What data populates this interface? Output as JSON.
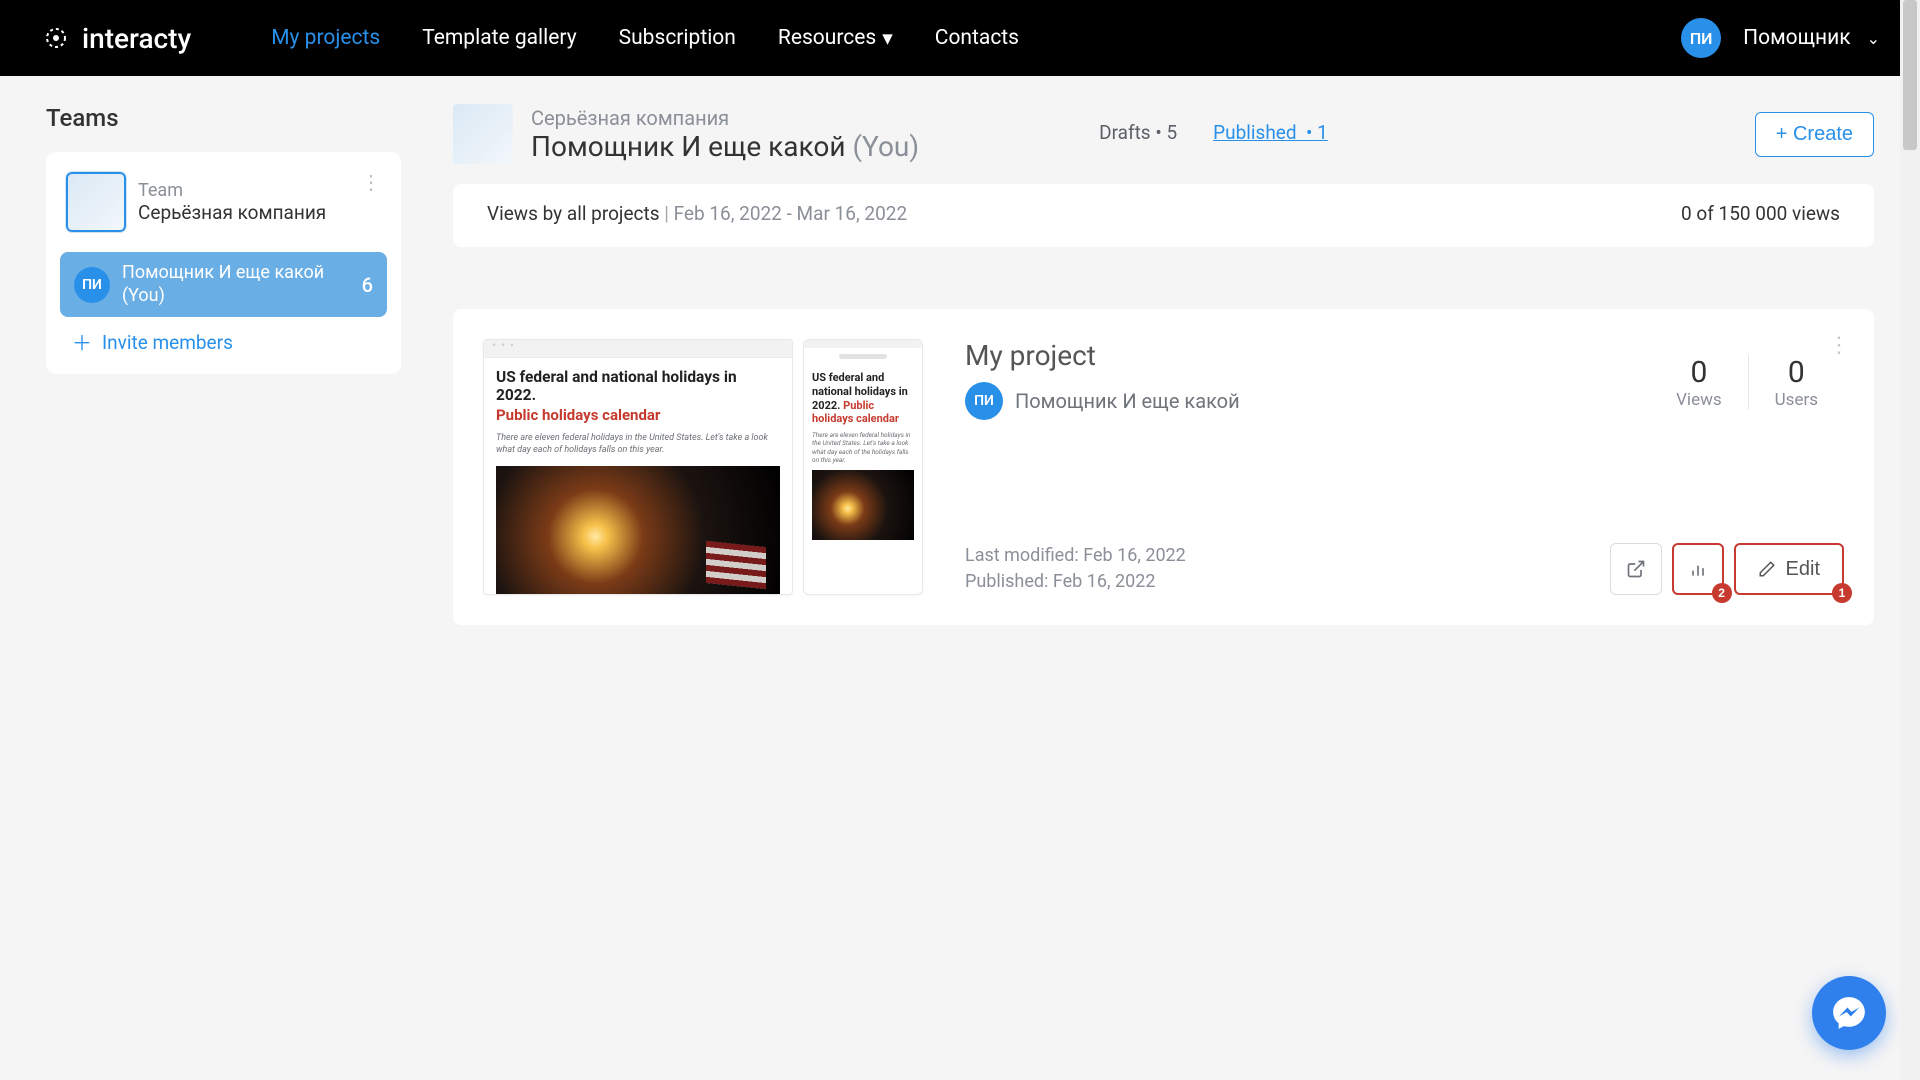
{
  "nav": {
    "brand": "interacty",
    "links": [
      "My projects",
      "Template gallery",
      "Subscription",
      "Resources",
      "Contacts"
    ]
  },
  "user": {
    "initials": "ПИ",
    "name": "Помощник"
  },
  "sidebar": {
    "title": "Teams",
    "team": {
      "label": "Team",
      "name": "Серьёзная компания"
    },
    "member": {
      "initials": "ПИ",
      "name": "Помощник И еще какой (You)",
      "count": "6"
    },
    "invite": "Invite members"
  },
  "workspace": {
    "company": "Серьёзная компания",
    "name": "Помощник И еще какой",
    "you": "(You)",
    "drafts_label": "Drafts",
    "drafts_count": "5",
    "published_label": "Published",
    "published_count": "1",
    "create": "+ Create"
  },
  "viewsbar": {
    "label": "Views by all projects",
    "range": "Feb 16, 2022 - Mar 16, 2022",
    "right": "0 of 150 000 views"
  },
  "project": {
    "title": "My project",
    "owner_initials": "ПИ",
    "owner": "Помощник И еще какой",
    "last_modified": "Last modified: Feb 16, 2022",
    "published": "Published: Feb 16, 2022",
    "views_num": "0",
    "views_lbl": "Views",
    "users_num": "0",
    "users_lbl": "Users",
    "edit": "Edit",
    "badge1": "1",
    "badge2": "2",
    "preview": {
      "h1": "US federal and national holidays in 2022.",
      "h2": "Public holidays calendar",
      "p": "There are eleven federal holidays in the United States. Let's take a look what day each of holidays falls on this year.",
      "m_h1": "US federal and national holidays in 2022.",
      "m_h2": "Public holidays calendar",
      "m_p": "There are eleven federal holidays in the United States. Let's take a look what day each of the holidays falls on this year."
    }
  }
}
